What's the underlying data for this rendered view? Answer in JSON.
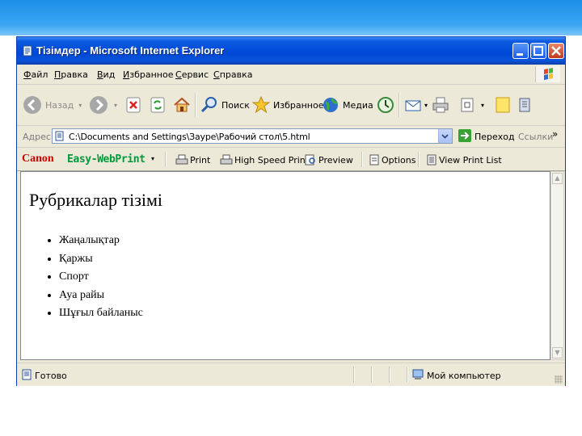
{
  "window": {
    "title": "Тізімдер - Microsoft Internet Explorer"
  },
  "menu": [
    {
      "accel": "Ф",
      "rest": "айл"
    },
    {
      "accel": "П",
      "rest": "равка"
    },
    {
      "accel": "В",
      "rest": "ид"
    },
    {
      "accel": "И",
      "rest": "збранное"
    },
    {
      "accel": "С",
      "rest": "ервис"
    },
    {
      "accel": "С",
      "rest": "правка"
    }
  ],
  "toolbar": {
    "back": "Назад",
    "search": "Поиск",
    "favorites": "Избранное",
    "media": "Медиа"
  },
  "address": {
    "label": "Адрес",
    "value": "C:\\Documents and Settings\\Зауре\\Рабочий стол\\5.html",
    "go": "Переход",
    "links": "Ссылки",
    "chevron": "»"
  },
  "printbar": {
    "brand": "Canon",
    "product": "Easy-WebPrint",
    "print": "Print",
    "high_speed": "High Speed Print",
    "preview": "Preview",
    "options": "Options",
    "view_list": "View Print List"
  },
  "page": {
    "heading": "Рубрикалар тізімі",
    "items": [
      "Жаңалықтар",
      "Қаржы",
      "Спорт",
      "Ауа райы",
      "Шұғыл байланыс"
    ]
  },
  "status": {
    "text": "Готово",
    "zone": "Мой компьютер"
  },
  "colors": {
    "titlebar": "#0048d6",
    "canon_red": "#cc0000",
    "ewp_green": "#009a3c",
    "slide_band": "#1d8fe8"
  }
}
